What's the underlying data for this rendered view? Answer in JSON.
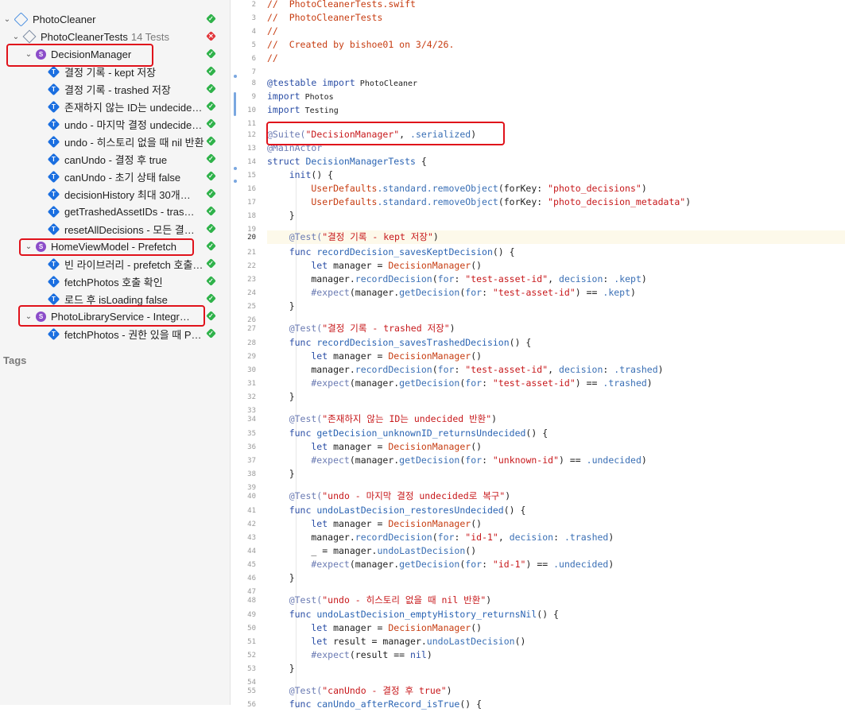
{
  "sidebar": {
    "project": "PhotoCleaner",
    "target": {
      "name": "PhotoCleanerTests",
      "count": "14 Tests"
    },
    "suites": [
      {
        "name": "DecisionManager",
        "tests": [
          "결정 기록 - kept 저장",
          "결정 기록 - trashed 저장",
          "존재하지 않는 ID는 undecide…",
          "undo - 마지막 결정 undecide…",
          "undo - 히스토리 없을 때 nil 반환",
          "canUndo - 결정 후 true",
          "canUndo - 초기 상태 false",
          "decisionHistory 최대 30개…",
          "getTrashedAssetIDs - tras…",
          "resetAllDecisions - 모든 결…"
        ]
      },
      {
        "name": "HomeViewModel - Prefetch",
        "tests": [
          "빈 라이브러리 - prefetch 호출…",
          "fetchPhotos 호출 확인",
          "로드 후 isLoading false"
        ]
      },
      {
        "name": "PhotoLibraryService - Integr…",
        "tests": [
          "fetchPhotos - 권한 있을 때 P…"
        ]
      }
    ],
    "tags_label": "Tags"
  },
  "editor": {
    "line_numbers": [
      "2",
      "3",
      "4",
      "5",
      "6",
      "7",
      "8",
      "9",
      "10",
      "11",
      "12",
      "13",
      "14",
      "15",
      "16",
      "17",
      "18",
      "19",
      "20",
      "21",
      "22",
      "23",
      "24",
      "25",
      "26",
      "27",
      "28",
      "29",
      "30",
      "31",
      "32",
      "33",
      "34",
      "35",
      "36",
      "37",
      "38",
      "39",
      "40",
      "41",
      "42",
      "43",
      "44",
      "45",
      "46",
      "47",
      "48",
      "49",
      "50",
      "51",
      "52",
      "53",
      "54",
      "55",
      "56"
    ],
    "active_line": "20",
    "code": {
      "l2": "//  PhotoCleanerTests.swift",
      "l3": "//  PhotoCleanerTests",
      "l4": "//",
      "l5": "//  Created by bishoe01 on 3/4/26.",
      "l6": "//",
      "l8a": "@testable",
      "l8b": " import",
      "l8c": " PhotoCleaner",
      "l9a": "import",
      "l9b": " Photos",
      "l10a": "import",
      "l10b": " Testing",
      "l12a": "@Suite(",
      "l12b": "\"DecisionManager\"",
      "l12c": ", ",
      "l12d": ".serialized",
      "l12e": ")",
      "l13": "@MainActor",
      "l14a": "struct",
      "l14b": " DecisionManagerTests",
      "l14c": " {",
      "l15a": "    init",
      "l15b": "() {",
      "l16a": "        UserDefaults",
      "l16b": ".standard",
      "l16c": ".removeObject",
      "l16d": "(forKey: ",
      "l16e": "\"photo_decisions\"",
      "l16f": ")",
      "l17a": "        UserDefaults",
      "l17b": ".standard",
      "l17c": ".removeObject",
      "l17d": "(forKey: ",
      "l17e": "\"photo_decision_metadata\"",
      "l17f": ")",
      "l18": "    }",
      "l20a": "    @Test(",
      "l20b": "\"결정 기록 - kept 저장\"",
      "l20c": ")",
      "l21a": "    func",
      "l21b": " recordDecision_savesKeptDecision",
      "l21c": "() {",
      "l22a": "        let",
      "l22b": " manager = ",
      "l22c": "DecisionManager",
      "l22d": "()",
      "l23a": "        manager.",
      "l23b": "recordDecision",
      "l23c": "(",
      "l23d": "for",
      "l23e": ": ",
      "l23f": "\"test-asset-id\"",
      "l23g": ", ",
      "l23h": "decision",
      "l23i": ": ",
      "l23j": ".kept",
      "l23k": ")",
      "l24a": "        #expect",
      "l24b": "(manager.",
      "l24c": "getDecision",
      "l24d": "(",
      "l24e": "for",
      "l24f": ": ",
      "l24g": "\"test-asset-id\"",
      "l24h": ") == ",
      "l24i": ".kept",
      "l24j": ")",
      "l25": "    }",
      "l27a": "    @Test(",
      "l27b": "\"결정 기록 - trashed 저장\"",
      "l27c": ")",
      "l28a": "    func",
      "l28b": " recordDecision_savesTrashedDecision",
      "l28c": "() {",
      "l29a": "        let",
      "l29b": " manager = ",
      "l29c": "DecisionManager",
      "l29d": "()",
      "l30a": "        manager.",
      "l30b": "recordDecision",
      "l30c": "(",
      "l30d": "for",
      "l30e": ": ",
      "l30f": "\"test-asset-id\"",
      "l30g": ", ",
      "l30h": "decision",
      "l30i": ": ",
      "l30j": ".trashed",
      "l30k": ")",
      "l31a": "        #expect",
      "l31b": "(manager.",
      "l31c": "getDecision",
      "l31d": "(",
      "l31e": "for",
      "l31f": ": ",
      "l31g": "\"test-asset-id\"",
      "l31h": ") == ",
      "l31i": ".trashed",
      "l31j": ")",
      "l32": "    }",
      "l34a": "    @Test(",
      "l34b": "\"존재하지 않는 ID는 undecided 반환\"",
      "l34c": ")",
      "l35a": "    func",
      "l35b": " getDecision_unknownID_returnsUndecided",
      "l35c": "() {",
      "l36a": "        let",
      "l36b": " manager = ",
      "l36c": "DecisionManager",
      "l36d": "()",
      "l37a": "        #expect",
      "l37b": "(manager.",
      "l37c": "getDecision",
      "l37d": "(",
      "l37e": "for",
      "l37f": ": ",
      "l37g": "\"unknown-id\"",
      "l37h": ") == ",
      "l37i": ".undecided",
      "l37j": ")",
      "l38": "    }",
      "l40a": "    @Test(",
      "l40b": "\"undo - 마지막 결정 undecided로 복구\"",
      "l40c": ")",
      "l41a": "    func",
      "l41b": " undoLastDecision_restoresUndecided",
      "l41c": "() {",
      "l42a": "        let",
      "l42b": " manager = ",
      "l42c": "DecisionManager",
      "l42d": "()",
      "l43a": "        manager.",
      "l43b": "recordDecision",
      "l43c": "(",
      "l43d": "for",
      "l43e": ": ",
      "l43f": "\"id-1\"",
      "l43g": ", ",
      "l43h": "decision",
      "l43i": ": ",
      "l43j": ".trashed",
      "l43k": ")",
      "l44a": "        _ = manager.",
      "l44b": "undoLastDecision",
      "l44c": "()",
      "l45a": "        #expect",
      "l45b": "(manager.",
      "l45c": "getDecision",
      "l45d": "(",
      "l45e": "for",
      "l45f": ": ",
      "l45g": "\"id-1\"",
      "l45h": ") == ",
      "l45i": ".undecided",
      "l45j": ")",
      "l46": "    }",
      "l48a": "    @Test(",
      "l48b": "\"undo - 히스토리 없을 때 nil 반환\"",
      "l48c": ")",
      "l49a": "    func",
      "l49b": " undoLastDecision_emptyHistory_returnsNil",
      "l49c": "() {",
      "l50a": "        let",
      "l50b": " manager = ",
      "l50c": "DecisionManager",
      "l50d": "()",
      "l51a": "        let",
      "l51b": " result = manager.",
      "l51c": "undoLastDecision",
      "l51d": "()",
      "l52a": "        #expect",
      "l52b": "(result == ",
      "l52c": "nil",
      "l52d": ")",
      "l53": "    }",
      "l55a": "    @Test(",
      "l55b": "\"canUndo - 결정 후 true\"",
      "l55c": ")",
      "l56a": "    func",
      "l56b": " canUndo_afterRecord_isTrue",
      "l56c": "() {"
    }
  }
}
